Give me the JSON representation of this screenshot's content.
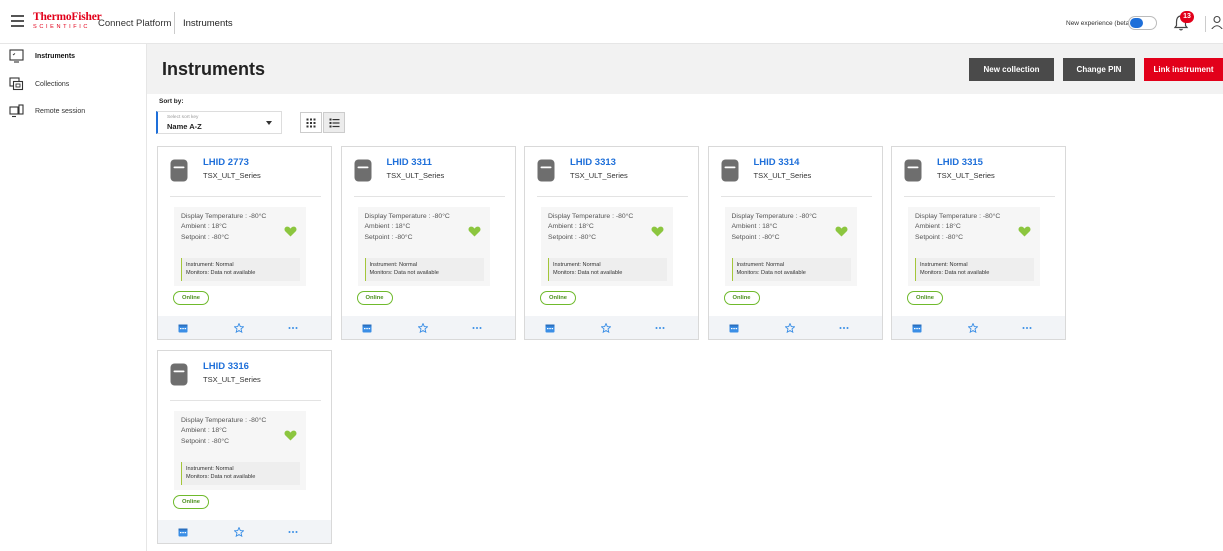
{
  "topbar": {
    "brand_line1": "ThermoFisher",
    "brand_line2": "SCIENTIFIC",
    "platform": "Connect Platform",
    "breadcrumb": "Instruments",
    "beta_label": "New experience (beta)",
    "notifications_count": "13",
    "accent": "#e2001a"
  },
  "sidebar": {
    "items": [
      {
        "label": "Instruments",
        "icon": "monitor-icon"
      },
      {
        "label": "Collections",
        "icon": "collections-icon"
      },
      {
        "label": "Remote session",
        "icon": "remote-session-icon"
      }
    ]
  },
  "main": {
    "title": "Instruments",
    "buttons": {
      "new_collection": "New collection",
      "change_pin": "Change PIN",
      "link_instrument": "Link instrument"
    },
    "sort": {
      "label": "Sort by:",
      "placeholder": "Select sort key",
      "value": "Name A-Z"
    }
  },
  "cards": [
    {
      "name": "LHID 2773",
      "series": "TSX_ULT_Series",
      "display_temp": "Display Temperature : -80°C",
      "ambient": "Ambient : 18°C",
      "setpoint": "Setpoint : -80°C",
      "instrument_status": "Instrument: Normal",
      "monitors_status": "Monitors: Data not available",
      "online": "Online"
    },
    {
      "name": "LHID 3311",
      "series": "TSX_ULT_Series",
      "display_temp": "Display Temperature : -80°C",
      "ambient": "Ambient : 18°C",
      "setpoint": "Setpoint : -80°C",
      "instrument_status": "Instrument: Normal",
      "monitors_status": "Monitors: Data not available",
      "online": "Online"
    },
    {
      "name": "LHID 3313",
      "series": "TSX_ULT_Series",
      "display_temp": "Display Temperature : -80°C",
      "ambient": "Ambient : 18°C",
      "setpoint": "Setpoint : -80°C",
      "instrument_status": "Instrument: Normal",
      "monitors_status": "Monitors: Data not available",
      "online": "Online"
    },
    {
      "name": "LHID 3314",
      "series": "TSX_ULT_Series",
      "display_temp": "Display Temperature : -80°C",
      "ambient": "Ambient : 18°C",
      "setpoint": "Setpoint : -80°C",
      "instrument_status": "Instrument: Normal",
      "monitors_status": "Monitors: Data not available",
      "online": "Online"
    },
    {
      "name": "LHID 3315",
      "series": "TSX_ULT_Series",
      "display_temp": "Display Temperature : -80°C",
      "ambient": "Ambient : 18°C",
      "setpoint": "Setpoint : -80°C",
      "instrument_status": "Instrument: Normal",
      "monitors_status": "Monitors: Data not available",
      "online": "Online"
    },
    {
      "name": "LHID 3316",
      "series": "TSX_ULT_Series",
      "display_temp": "Display Temperature : -80°C",
      "ambient": "Ambient : 18°C",
      "setpoint": "Setpoint : -80°C",
      "instrument_status": "Instrument: Normal",
      "monitors_status": "Monitors: Data not available",
      "online": "Online"
    }
  ]
}
